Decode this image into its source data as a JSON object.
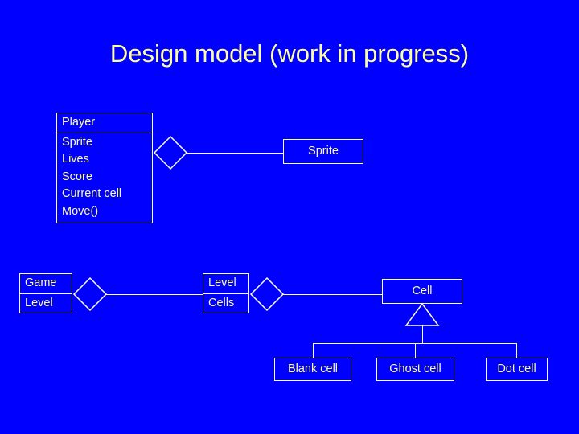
{
  "slide": {
    "title": "Design model (work in progress)",
    "background_color": "#0000ff",
    "line_color": "#ffffcc",
    "text_color": "#ffff99"
  },
  "diagram": {
    "classes": {
      "player": {
        "name": "Player",
        "attributes": [
          "Sprite",
          "Lives",
          "Score",
          "Current cell",
          "Move()"
        ]
      },
      "sprite": {
        "name": "Sprite",
        "attributes": []
      },
      "game": {
        "name": "Game",
        "attributes": [
          "Level"
        ]
      },
      "level": {
        "name": "Level",
        "attributes": [
          "Cells"
        ]
      },
      "cell": {
        "name": "Cell",
        "attributes": []
      },
      "blank_cell": {
        "name": "Blank cell",
        "attributes": []
      },
      "ghost_cell": {
        "name": "Ghost cell",
        "attributes": []
      },
      "dot_cell": {
        "name": "Dot cell",
        "attributes": []
      }
    },
    "relationships": [
      {
        "type": "aggregation",
        "from": "player",
        "to": "sprite"
      },
      {
        "type": "aggregation",
        "from": "game",
        "to": "level"
      },
      {
        "type": "aggregation",
        "from": "level",
        "to": "cell"
      },
      {
        "type": "generalization",
        "from": "blank_cell",
        "to": "cell"
      },
      {
        "type": "generalization",
        "from": "ghost_cell",
        "to": "cell"
      },
      {
        "type": "generalization",
        "from": "dot_cell",
        "to": "cell"
      }
    ]
  }
}
